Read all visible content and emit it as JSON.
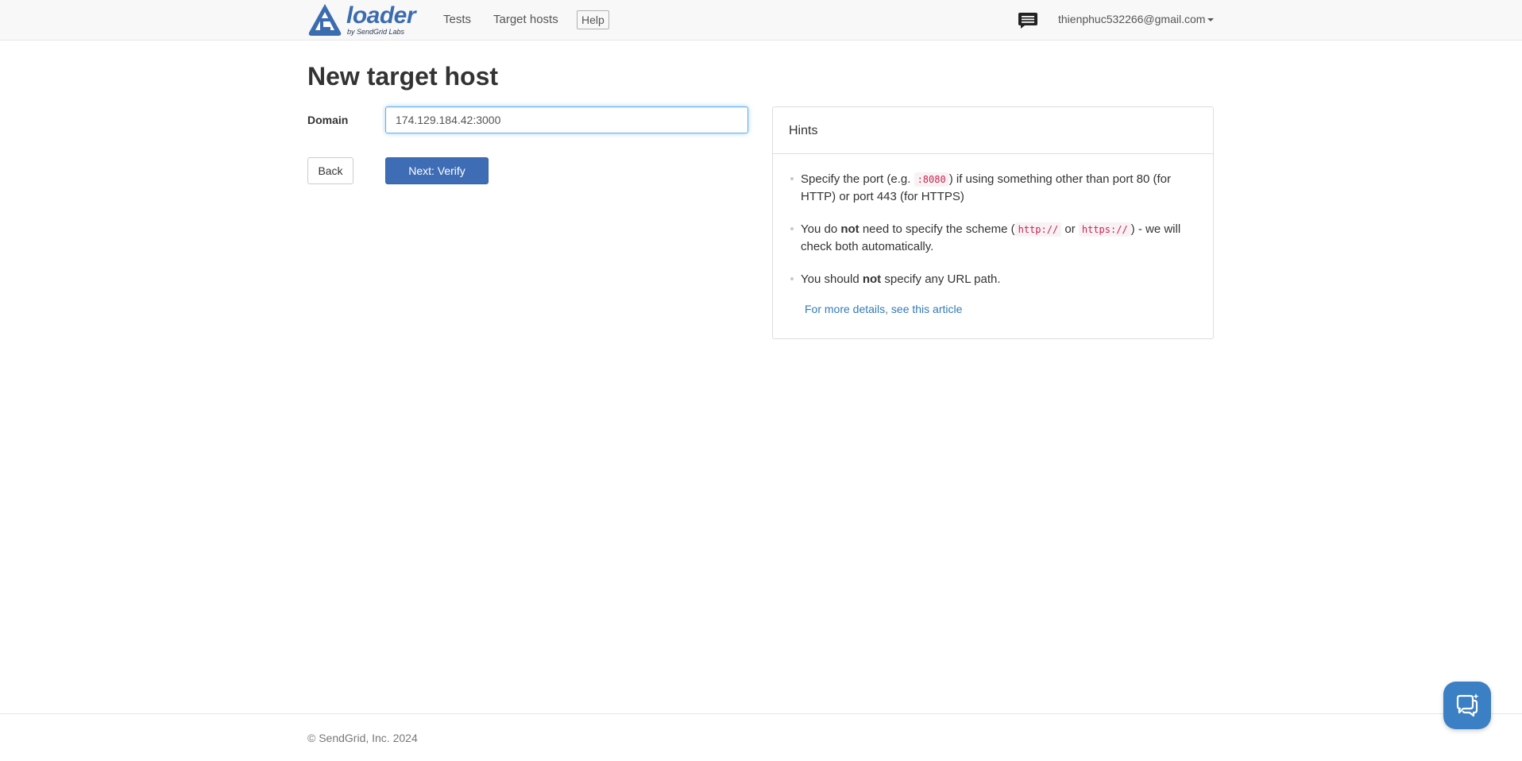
{
  "brand": {
    "name": "loader",
    "subtitle": "by SendGrid Labs"
  },
  "nav": {
    "tests": "Tests",
    "target_hosts": "Target hosts",
    "help": "Help",
    "user_email": "thienphuc532266@gmail.com"
  },
  "page": {
    "title": "New target host"
  },
  "form": {
    "domain_label": "Domain",
    "domain_value": "174.129.184.42:3000",
    "back_label": "Back",
    "next_label": "Next: Verify"
  },
  "hints": {
    "heading": "Hints",
    "hint1": {
      "pre": "Specify the port (e.g. ",
      "code": ":8080",
      "post": ") if using something other than port 80 (for HTTP) or port 443 (for HTTPS)"
    },
    "hint2": {
      "pre": "You do ",
      "bold": "not",
      "mid": " need to specify the scheme (",
      "code1": "http://",
      "or": " or ",
      "code2": "https://",
      "post": ") - we will check both automatically."
    },
    "hint3": {
      "pre": "You should ",
      "bold": "not",
      "post": " specify any URL path."
    },
    "more_link": "For more details, see this article"
  },
  "footer": {
    "copyright": "© SendGrid, Inc. 2024"
  },
  "colors": {
    "brand_blue": "#3b6cb0",
    "primary_button": "#3f6db5",
    "link": "#337ab7",
    "code_text": "#c7254e",
    "chat_widget": "#3b7fc4"
  },
  "icons": {
    "logo": "loader-logo-icon",
    "chat_nav": "chat-bubble-icon",
    "chat_widget": "chat-widget-icon",
    "caret": "caret-down-icon"
  }
}
